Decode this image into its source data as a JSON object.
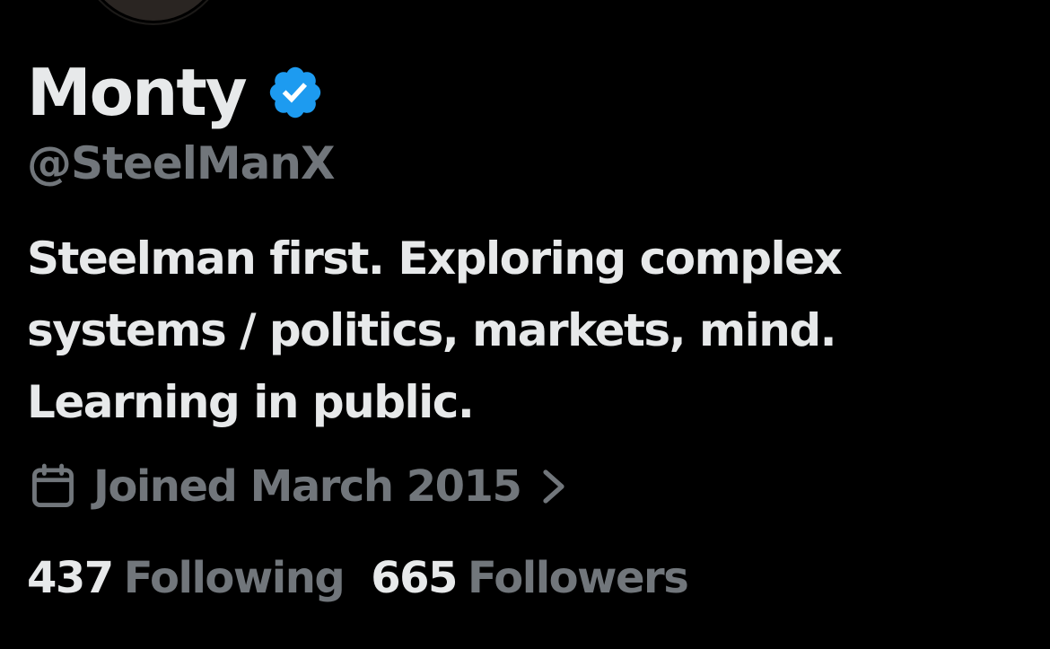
{
  "profile": {
    "display_name": "Monty",
    "verified": true,
    "handle": "@SteelManX",
    "bio_lines": [
      "Steelman first. Exploring complex",
      "systems / politics, markets, mind.",
      "Learning in public."
    ],
    "joined": {
      "icon": "calendar-icon",
      "text": "Joined March 2015"
    },
    "stats": {
      "following_count": "437",
      "following_label": "Following",
      "followers_count": "665",
      "followers_label": "Followers"
    }
  },
  "colors": {
    "background": "#000000",
    "primary_text": "#e7e9ea",
    "secondary_text": "#71767b",
    "verified_blue": "#1d9bf0"
  }
}
